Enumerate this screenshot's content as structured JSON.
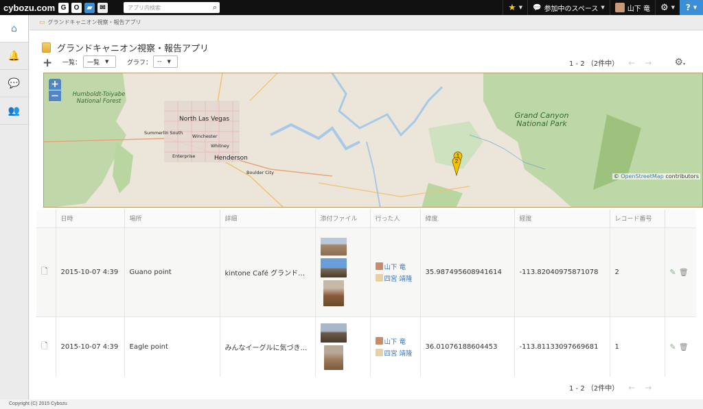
{
  "topbar": {
    "logo": "cybozu.com",
    "search_placeholder": "アプリ内検索",
    "spaces_label": "参加中のスペース",
    "user_name": "山下 竜",
    "help_label": "?"
  },
  "breadcrumb": {
    "text": "グランドキャニオン視察・報告アプリ"
  },
  "app": {
    "title": "グランドキャニオン視察・報告アプリ",
    "view_label": "一覧：",
    "view_value": "一覧",
    "graph_label": "グラフ：",
    "graph_value": "--",
    "pager_top": "1 - 2 （2件中）",
    "pager_bottom": "1 - 2 （2件中）"
  },
  "map": {
    "labels": {
      "humboldt": "Humboldt-Toiyabe National Forest",
      "north_las_vegas": "North Las Vegas",
      "summerlin": "Summerlin South",
      "winchester": "Winchester",
      "whitney": "Whitney",
      "enterprise": "Enterprise",
      "henderson": "Henderson",
      "boulder": "Boulder City",
      "grand_canyon": "Grand Canyon National Park"
    },
    "attribution_prefix": "©",
    "attribution_link": "OpenStreetMap",
    "attribution_suffix": "contributors",
    "markers": [
      "1",
      "2"
    ]
  },
  "table": {
    "headers": [
      "日時",
      "場所",
      "詳細",
      "添付ファイル",
      "行った人",
      "緯度",
      "経度",
      "レコード番号"
    ],
    "rows": [
      {
        "datetime": "2015-10-07 4:39",
        "place": "Guano point",
        "detail": "kintone Café グランド…",
        "people": [
          "山下 竜",
          "四宮 靖隆"
        ],
        "lat": "35.987495608941614",
        "lng": "-113.82040975871078",
        "record": "2"
      },
      {
        "datetime": "2015-10-07 4:39",
        "place": "Eagle point",
        "detail": "みんなイーグルに気づき…",
        "people": [
          "山下 竜",
          "四宮 靖隆"
        ],
        "lat": "36.01076188604453",
        "lng": "-113.81133097669681",
        "record": "1"
      }
    ]
  },
  "footer": {
    "copyright": "Copyright (C) 2015 Cybozu"
  }
}
